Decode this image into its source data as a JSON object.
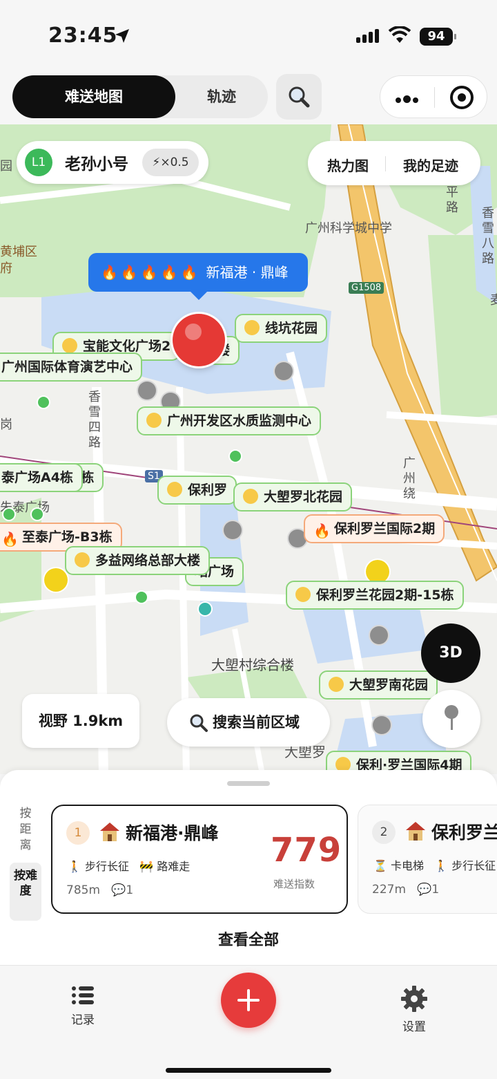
{
  "status_bar": {
    "time": "23:45",
    "battery": "94"
  },
  "topbar": {
    "tab_active": "难送地图",
    "tab_other": "轨迹"
  },
  "user": {
    "level": "L1",
    "name": "老孙小号",
    "multiplier": "⚡×0.5"
  },
  "map_actions": {
    "heatmap": "热力图",
    "footprint": "我的足迹"
  },
  "selected": {
    "fires": "🔥🔥🔥🔥🔥",
    "name": "新福港 · 鼎峰"
  },
  "map_labels": {
    "school": "广州科学城中学",
    "highway": "G1508",
    "road_s": "S1",
    "district": "黄埔区",
    "district2": "府",
    "road_xiangxue": "香雪四路",
    "road_ping": "平路",
    "road_xiangxue8": "香雪八路",
    "road_guangzhou": "广州绕",
    "building": "大塱村综合楼",
    "yuan": "园",
    "gang": "岗",
    "zhu": "朱泰广场",
    "dadong": "大塱",
    "bottom": "大塱罗",
    "mai": "麦"
  },
  "places": [
    {
      "name": "线坑花园",
      "kind": "meh"
    },
    {
      "name": "广州国际体育演艺中心",
      "kind": "plain"
    },
    {
      "name": "广州开发区水质监测中心",
      "kind": "cool"
    },
    {
      "name": "泰广场A4栋",
      "kind": "plain"
    },
    {
      "name": "3栋",
      "kind": "plain"
    },
    {
      "name": "保利罗",
      "kind": "meh"
    },
    {
      "name": "大塱罗北花园",
      "kind": "meh"
    },
    {
      "name": "保利罗兰国际2期",
      "kind": "hot"
    },
    {
      "name": "至泰广场-B3栋",
      "kind": "hot"
    },
    {
      "name": "多益网络总部大楼",
      "kind": "cool"
    },
    {
      "name": "珺广场",
      "kind": "plain"
    },
    {
      "name": "保利罗兰花园2期-15栋",
      "kind": "meh"
    },
    {
      "name": "大塱罗南花园",
      "kind": "meh"
    },
    {
      "name": "保利·罗兰国际4期",
      "kind": "meh"
    },
    {
      "name": "宝能文化广场2",
      "kind": "meh"
    },
    {
      "name": "楼",
      "kind": "plain"
    }
  ],
  "map_controls": {
    "btn_3d": "3D",
    "view": "视野 1.9km",
    "search_area": "搜索当前区域"
  },
  "sheet": {
    "sort_distance": "按距离",
    "sort_difficulty": "按难度",
    "view_all": "查看全部",
    "cards": [
      {
        "rank": "1",
        "name": "新福港·鼎峰",
        "tag1": "🚶 步行长征",
        "tag2": "🚧 路难走",
        "distance": "785m",
        "comments": "💬1",
        "score": "779",
        "score_label": "难送指数"
      },
      {
        "rank": "2",
        "name": "保利罗兰",
        "tag1": "⏳ 卡电梯",
        "tag2": "🚶 步行长征",
        "distance": "227m",
        "comments": "💬1"
      }
    ]
  },
  "tabbar": {
    "records": "记录",
    "settings": "设置"
  },
  "colors": {
    "accent_red": "#e63b3b",
    "bubble_blue": "#2677ea",
    "tag_green": "#8bd37a",
    "level_green": "#3cb95a",
    "score_red": "#c8403a"
  }
}
